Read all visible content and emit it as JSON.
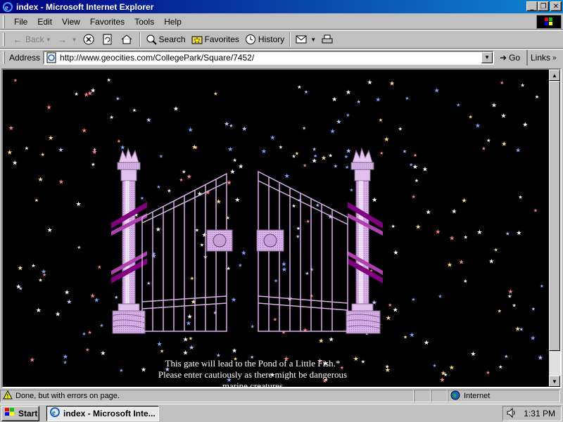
{
  "window": {
    "title": "index - Microsoft Internet Explorer",
    "controls": {
      "minimize": "_",
      "maximize": "❐",
      "close": "✕"
    }
  },
  "menu": [
    "File",
    "Edit",
    "View",
    "Favorites",
    "Tools",
    "Help"
  ],
  "toolbar": {
    "back": "Back",
    "forward_icon": "forward-arrow-icon",
    "stop_icon": "stop-icon",
    "refresh_icon": "refresh-icon",
    "home_icon": "home-icon",
    "search": "Search",
    "favorites": "Favorites",
    "history": "History",
    "mail_icon": "mail-icon",
    "print_icon": "print-icon"
  },
  "address": {
    "label": "Address",
    "url": "http://www.geocities.com/CollegePark/Square/7452/",
    "go": "Go",
    "links": "Links"
  },
  "content": {
    "background": "#000000",
    "gate_text": "This gate will lead to the Pond of a Little Fish.* Please enter cautiously as there might be dangerous marine creatures"
  },
  "status": {
    "message": "Done, but with errors on page.",
    "zone": "Internet"
  },
  "taskbar": {
    "start": "Start",
    "task": "index - Microsoft Inte...",
    "time": "1:31 PM"
  },
  "colors": {
    "title_from": "#000080",
    "title_to": "#1084d0",
    "gate_lavender": "#d8b0e8",
    "ribbon_purple": "#800080"
  }
}
